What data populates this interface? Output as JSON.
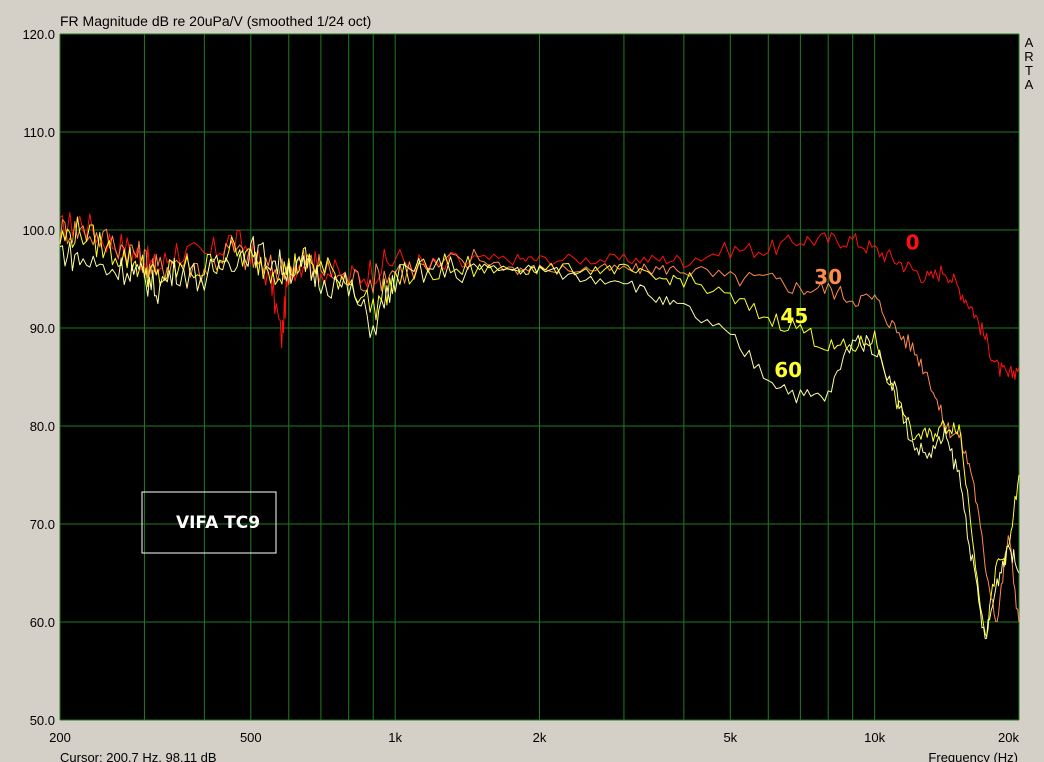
{
  "chart_data": {
    "type": "line",
    "title": "FR Magnitude dB re 20uPa/V (smoothed 1/24 oct)",
    "xlabel": "Frequency (Hz)",
    "ylabel": "",
    "xscale": "log",
    "xlim": [
      200,
      20000
    ],
    "ylim": [
      50,
      120
    ],
    "grid": true,
    "background": "#000000",
    "grid_color": "#1e7d1e",
    "x_ticks": [
      {
        "value": 200,
        "label": "200"
      },
      {
        "value": 500,
        "label": "500"
      },
      {
        "value": 1000,
        "label": "1k"
      },
      {
        "value": 2000,
        "label": "2k"
      },
      {
        "value": 5000,
        "label": "5k"
      },
      {
        "value": 10000,
        "label": "10k"
      },
      {
        "value": 20000,
        "label": "20k"
      }
    ],
    "y_ticks": [
      {
        "value": 50,
        "label": "50.0"
      },
      {
        "value": 60,
        "label": "60.0"
      },
      {
        "value": 70,
        "label": "70.0"
      },
      {
        "value": 80,
        "label": "80.0"
      },
      {
        "value": 90,
        "label": "90.0"
      },
      {
        "value": 100,
        "label": "100.0"
      },
      {
        "value": 110,
        "label": "110.0"
      },
      {
        "value": 120,
        "label": "120.0"
      }
    ],
    "series": [
      {
        "name": "0",
        "color": "#ff1010",
        "x": [
          200,
          220,
          250,
          280,
          300,
          320,
          350,
          400,
          450,
          500,
          550,
          580,
          600,
          650,
          700,
          800,
          900,
          1000,
          1200,
          1500,
          1800,
          2000,
          2500,
          3000,
          3500,
          4000,
          5000,
          6000,
          7000,
          8000,
          9000,
          10000,
          11000,
          12000,
          13000,
          14000,
          15000,
          16000,
          17000,
          18000,
          19000,
          20000
        ],
        "y": [
          100,
          101,
          99,
          98,
          97,
          96,
          98,
          97,
          99,
          98,
          95,
          89,
          96,
          97,
          96,
          95,
          96,
          97,
          96,
          97,
          97,
          97,
          97,
          97,
          97,
          97,
          98,
          98,
          99,
          99,
          99,
          98,
          97,
          96,
          95,
          96,
          94,
          92,
          89,
          86,
          85,
          86
        ]
      },
      {
        "name": "30",
        "color": "#ff8a50",
        "x": [
          200,
          220,
          250,
          280,
          300,
          320,
          350,
          400,
          450,
          500,
          550,
          600,
          650,
          700,
          800,
          900,
          1000,
          1200,
          1500,
          1800,
          2000,
          2500,
          3000,
          3500,
          4000,
          5000,
          6000,
          7000,
          8000,
          9000,
          10000,
          11000,
          12000,
          13000,
          14000,
          15000,
          16000,
          17000,
          18000,
          19000,
          20000
        ],
        "y": [
          100,
          100,
          99,
          98,
          97,
          96,
          97,
          96,
          98,
          97,
          96,
          96,
          97,
          96,
          95,
          95,
          96,
          96,
          97,
          96,
          96,
          96,
          96,
          96,
          96,
          95,
          95,
          94,
          94,
          93,
          93,
          90,
          88,
          85,
          80,
          79,
          75,
          66,
          60,
          69,
          60
        ]
      },
      {
        "name": "45",
        "color": "#ffff30",
        "x": [
          200,
          220,
          250,
          280,
          300,
          320,
          350,
          400,
          450,
          500,
          550,
          600,
          650,
          700,
          800,
          900,
          1000,
          1200,
          1500,
          1800,
          2000,
          2500,
          3000,
          3500,
          4000,
          5000,
          6000,
          7000,
          8000,
          9000,
          10000,
          11000,
          12000,
          13000,
          14000,
          15000,
          16000,
          17000,
          18000,
          19000,
          20000
        ],
        "y": [
          99,
          100,
          98,
          97,
          96,
          95,
          96,
          96,
          98,
          97,
          96,
          96,
          97,
          96,
          95,
          92,
          95,
          96,
          96,
          96,
          96,
          96,
          96,
          95,
          95,
          93,
          91,
          90,
          88,
          88,
          89,
          83,
          79,
          79,
          80,
          80,
          69,
          58,
          66,
          67,
          75
        ]
      },
      {
        "name": "60",
        "color": "#ffffa0",
        "x": [
          200,
          220,
          250,
          280,
          300,
          320,
          350,
          400,
          450,
          500,
          550,
          600,
          650,
          700,
          800,
          900,
          1000,
          1200,
          1500,
          1800,
          2000,
          2500,
          3000,
          3500,
          4000,
          5000,
          6000,
          7000,
          8000,
          9000,
          10000,
          11000,
          12000,
          13000,
          14000,
          15000,
          16000,
          17000,
          18000,
          19000,
          20000
        ],
        "y": [
          98,
          97,
          96,
          96,
          95,
          94,
          96,
          95,
          97,
          98,
          97,
          96,
          96,
          95,
          94,
          90,
          95,
          96,
          96,
          96,
          96,
          95,
          95,
          93,
          92,
          89,
          85,
          83,
          83,
          89,
          88,
          84,
          78,
          77,
          79,
          75,
          66,
          58,
          64,
          68,
          65
        ]
      }
    ],
    "annotations": [
      {
        "text": "0",
        "x": 12000,
        "y": 98,
        "color": "#ff1010"
      },
      {
        "text": "30",
        "x": 8000,
        "y": 94.5,
        "color": "#ff8a50"
      },
      {
        "text": "45",
        "x": 6800,
        "y": 90.5,
        "color": "#ffff30"
      },
      {
        "text": "60",
        "x": 6600,
        "y": 85,
        "color": "#ffff30"
      }
    ],
    "legend_box_text": "VIFA TC9",
    "side_text": [
      "A",
      "R",
      "T",
      "A"
    ],
    "cursor_text": "Cursor: 200.7 Hz, 98.11 dB"
  }
}
